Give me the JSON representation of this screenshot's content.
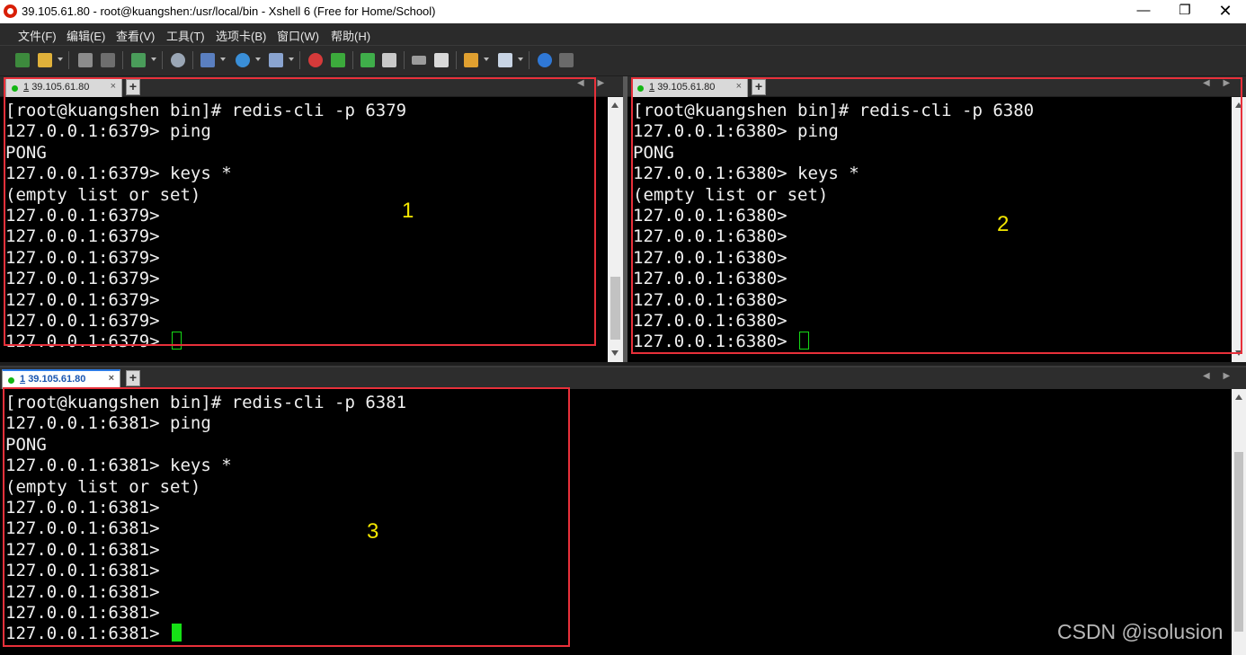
{
  "window": {
    "title": "39.105.61.80 - root@kuangshen:/usr/local/bin - Xshell 6 (Free for Home/School)",
    "controls": {
      "minimize": "—",
      "maximize": "❐",
      "close": "✕"
    }
  },
  "menu": {
    "items": [
      "文件(F)",
      "编辑(E)",
      "查看(V)",
      "工具(T)",
      "选项卡(B)",
      "窗口(W)",
      "帮助(H)"
    ]
  },
  "toolbar": {
    "icons": [
      "new-session-icon",
      "open-folder-icon",
      "disconnect-icon",
      "reconnect-icon",
      "new-tab-icon",
      "search-icon",
      "transfer-icon",
      "globe-icon",
      "font-icon",
      "xftp-icon",
      "xmanager-icon",
      "fullscreen-icon",
      "lock-icon",
      "keyboard-icon",
      "highlight-icon",
      "compose-icon",
      "layout-icon",
      "help-icon",
      "chat-icon"
    ]
  },
  "panes": [
    {
      "tab": {
        "number": "1",
        "host": "39.105.61.80",
        "close": "×"
      },
      "lines": [
        "[root@kuangshen bin]# redis-cli -p 6379",
        "127.0.0.1:6379> ping",
        "PONG",
        "127.0.0.1:6379> keys *",
        "(empty list or set)",
        "127.0.0.1:6379>",
        "127.0.0.1:6379>",
        "127.0.0.1:6379>",
        "127.0.0.1:6379>",
        "127.0.0.1:6379>",
        "127.0.0.1:6379>"
      ],
      "prompt": "127.0.0.1:6379> ",
      "label": "1"
    },
    {
      "tab": {
        "number": "1",
        "host": "39.105.61.80",
        "close": "×"
      },
      "lines": [
        "[root@kuangshen bin]# redis-cli -p 6380",
        "127.0.0.1:6380> ping",
        "PONG",
        "127.0.0.1:6380> keys *",
        "(empty list or set)",
        "127.0.0.1:6380>",
        "127.0.0.1:6380>",
        "127.0.0.1:6380>",
        "127.0.0.1:6380>",
        "127.0.0.1:6380>",
        "127.0.0.1:6380>"
      ],
      "prompt": "127.0.0.1:6380> ",
      "label": "2"
    },
    {
      "tab": {
        "number": "1",
        "host": "39.105.61.80",
        "close": "×"
      },
      "lines": [
        "[root@kuangshen bin]# redis-cli -p 6381",
        "127.0.0.1:6381> ping",
        "PONG",
        "127.0.0.1:6381> keys *",
        "(empty list or set)",
        "127.0.0.1:6381>",
        "127.0.0.1:6381>",
        "127.0.0.1:6381>",
        "127.0.0.1:6381>",
        "127.0.0.1:6381>",
        "127.0.0.1:6381>"
      ],
      "prompt": "127.0.0.1:6381> ",
      "label": "3"
    }
  ],
  "tab_add": "+",
  "strip_arrows": "◀ ▶",
  "watermark": "CSDN @isolusion",
  "colors": {
    "highlight_box": "#e8303a",
    "pane_number": "#f2e600",
    "cursor": "#16e016",
    "tab_dot": "#13b613"
  }
}
